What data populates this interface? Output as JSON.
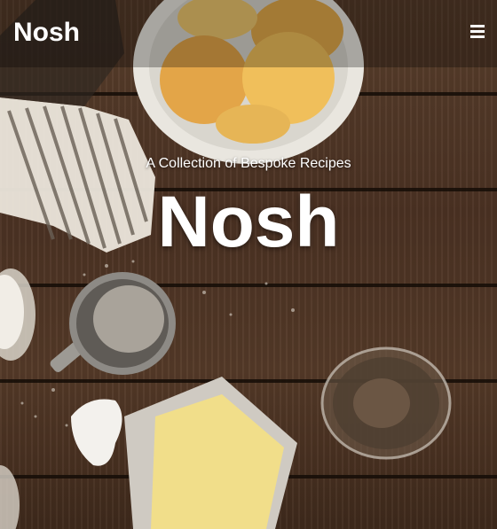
{
  "navbar": {
    "brand": "Nosh",
    "menu_icon": "hamburger-menu-icon"
  },
  "hero": {
    "tagline": "A Collection of Bespoke Recipes",
    "title": "Nosh"
  },
  "colors": {
    "text": "#ffffff",
    "wood": "#4b3223",
    "navbar_overlay": "rgba(0,0,0,0.28)"
  }
}
